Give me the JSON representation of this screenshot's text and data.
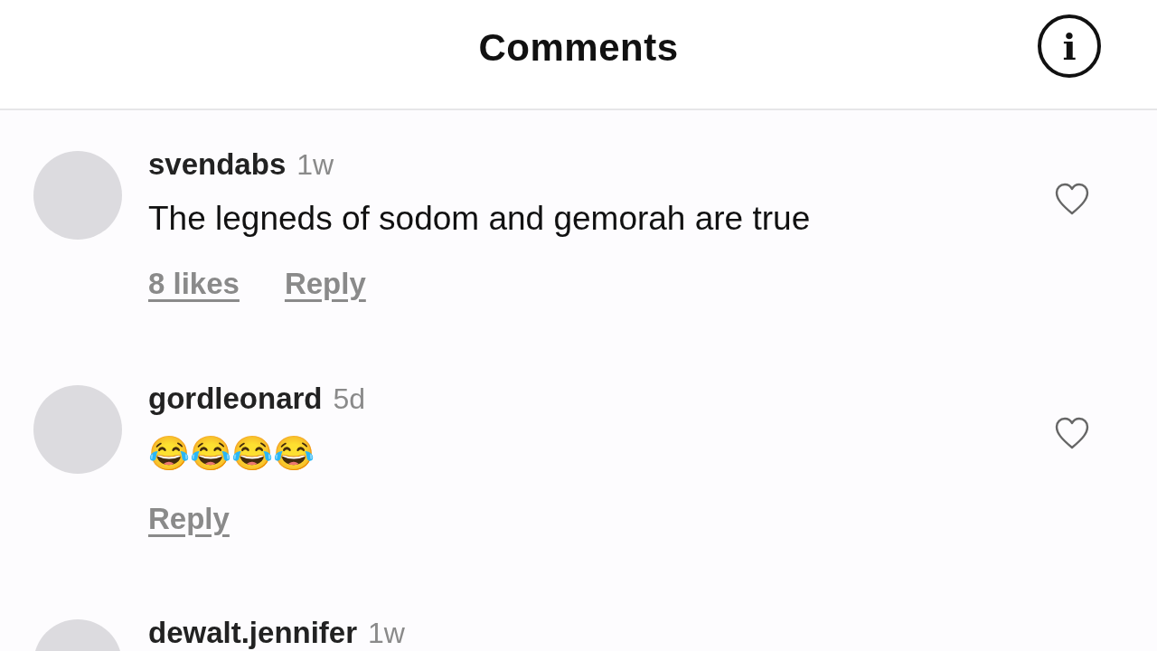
{
  "header": {
    "title": "Comments",
    "info_icon": "i"
  },
  "comments": [
    {
      "username": "svendabs",
      "time": "1w",
      "text": "The legneds of sodom and gemorah are true",
      "likes": "8 likes",
      "reply": "Reply",
      "liked": false
    },
    {
      "username": "gordleonard",
      "time": "5d",
      "text": "😂😂😂😂",
      "reply": "Reply",
      "liked": false
    },
    {
      "username": "dewalt.jennifer",
      "time": "1w"
    }
  ]
}
